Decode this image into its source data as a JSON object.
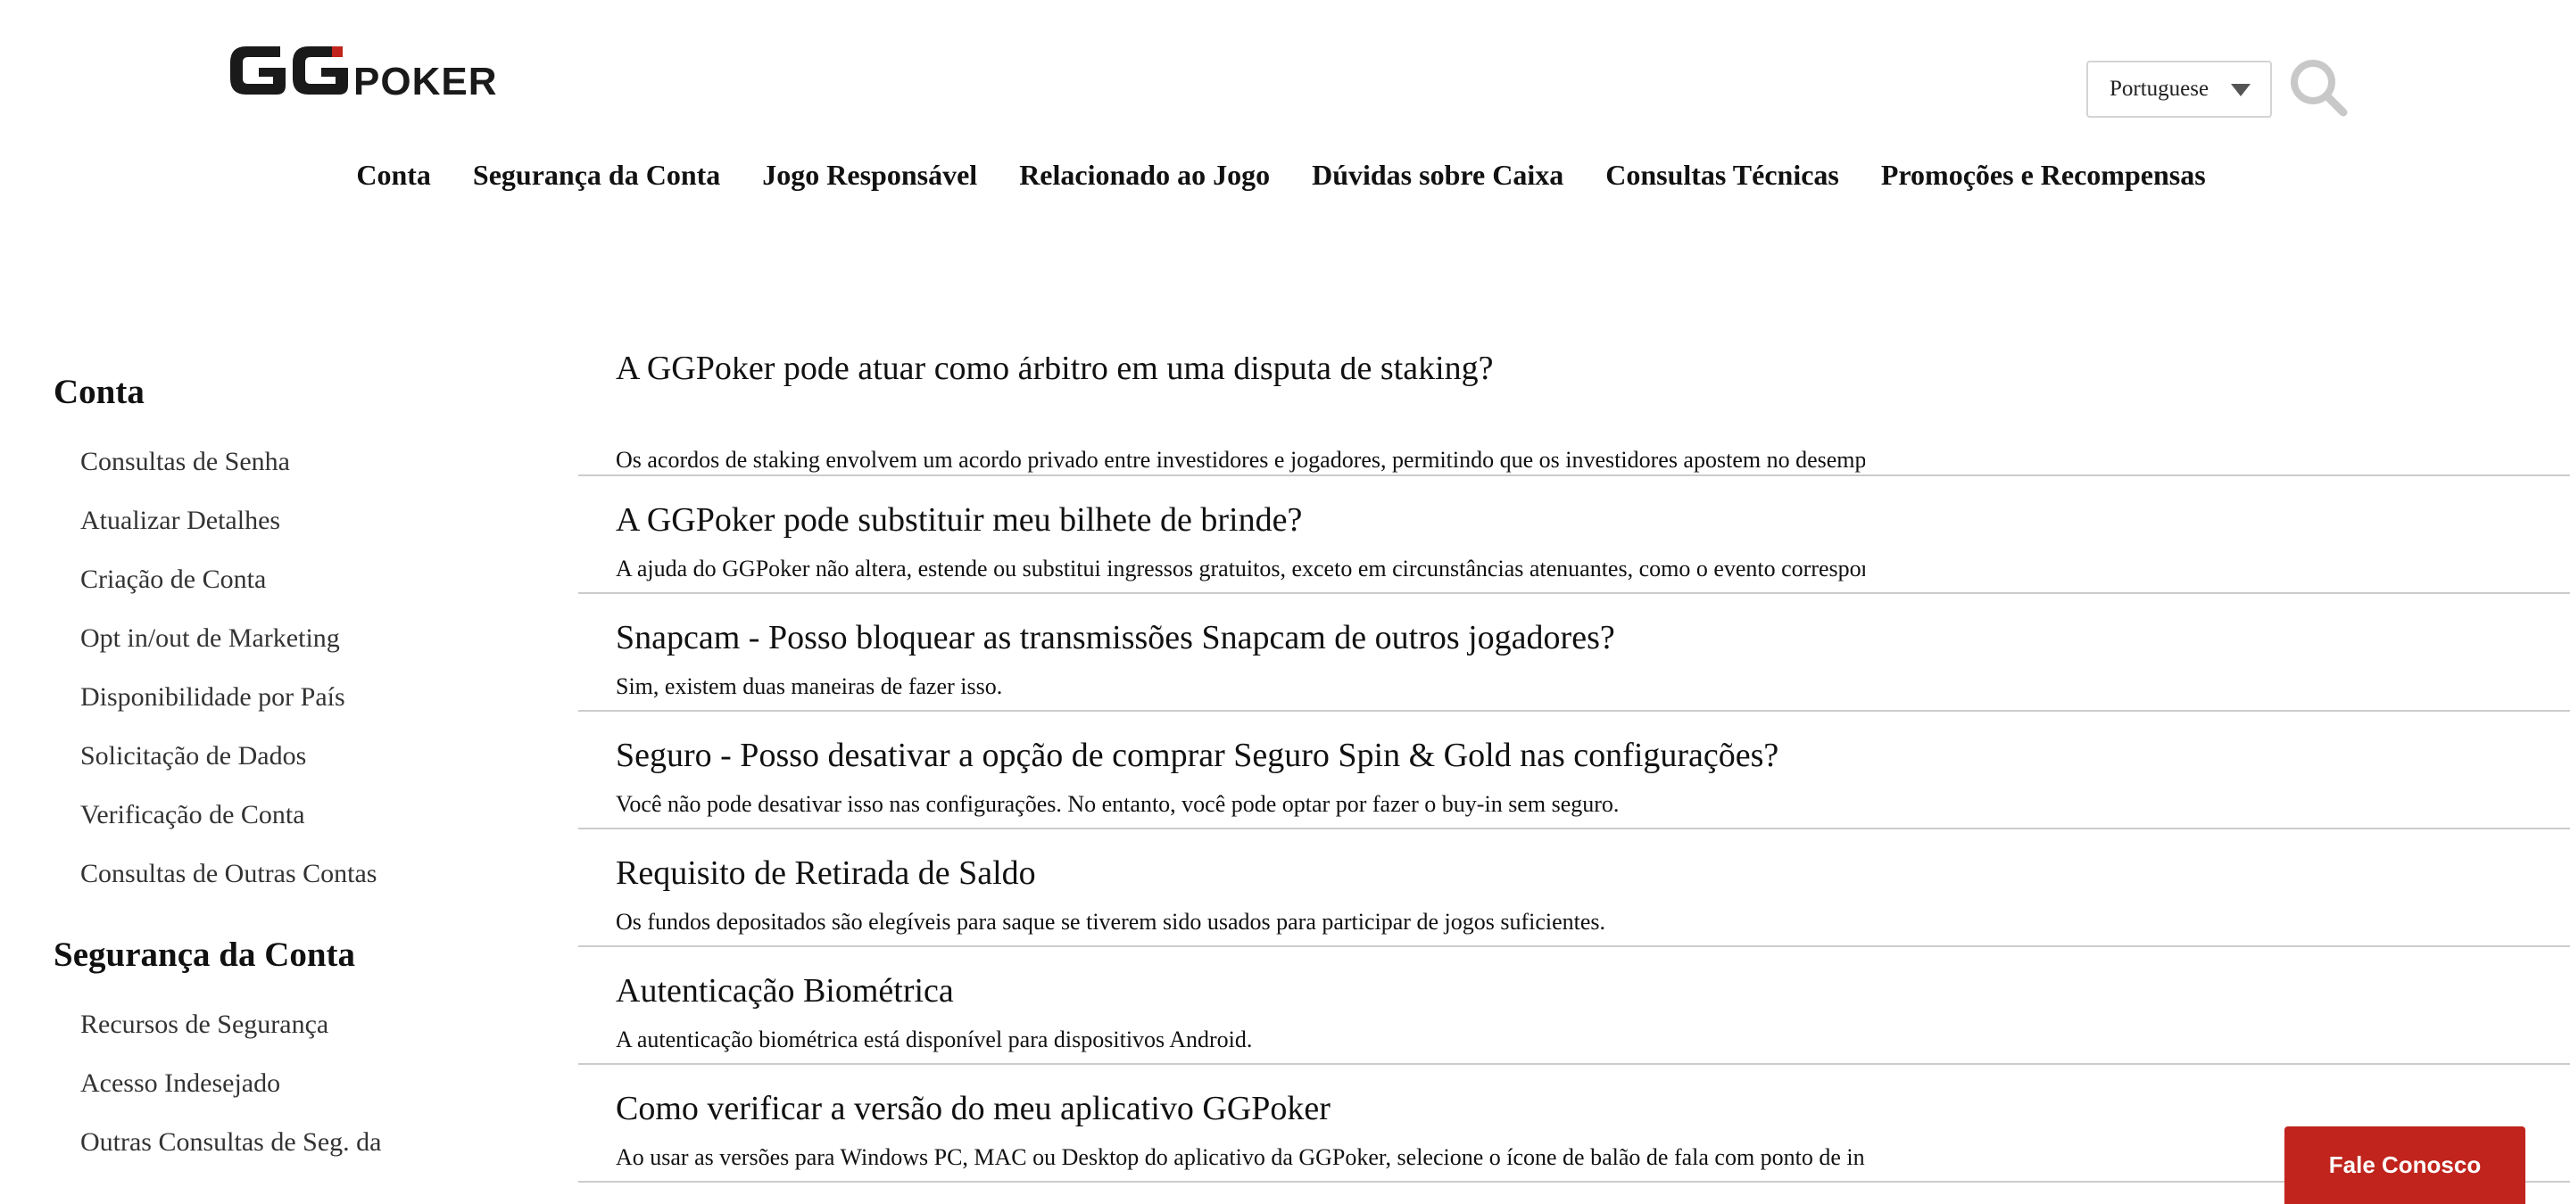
{
  "brand": {
    "logo_text": "GGPOKER",
    "accent_color": "#c0241c"
  },
  "header": {
    "language": {
      "selected": "Portuguese"
    },
    "search_icon": "search-icon"
  },
  "main_nav": [
    "Conta",
    "Segurança da Conta",
    "Jogo Responsável",
    "Relacionado ao Jogo",
    "Dúvidas sobre Caixa",
    "Consultas Técnicas",
    "Promoções e Recompensas"
  ],
  "sidebar": {
    "sections": [
      {
        "title": "Conta",
        "items": [
          "Consultas de Senha",
          "Atualizar Detalhes",
          "Criação de Conta",
          "Opt in/out de Marketing",
          "Disponibilidade por País",
          "Solicitação de Dados",
          "Verificação de Conta",
          "Consultas de Outras Contas"
        ]
      },
      {
        "title": "Segurança da Conta",
        "items": [
          "Recursos de Segurança",
          "Acesso Indesejado",
          "Outras Consultas de Seg. da"
        ]
      }
    ]
  },
  "articles": [
    {
      "title": "A GGPoker pode atuar como árbitro em uma disputa de staking?",
      "excerpt": "Os acordos de staking envolvem um acordo privado entre investidores e jogadores, permitindo que os investidores apostem no desempenho de um jogador e"
    },
    {
      "title": "A GGPoker pode substituir meu bilhete de brinde?",
      "excerpt": "A ajuda do GGPoker não altera, estende ou substitui ingressos gratuitos, exceto em circunstâncias atenuantes, como o evento correspondente não ocorrer ou"
    },
    {
      "title": "Snapcam - Posso bloquear as transmissões Snapcam de outros jogadores?",
      "excerpt": "Sim, existem duas maneiras de fazer isso."
    },
    {
      "title": "Seguro - Posso desativar a opção de comprar Seguro Spin & Gold nas configurações?",
      "excerpt": "Você não pode desativar isso nas configurações. No entanto, você pode optar por fazer o buy-in sem seguro."
    },
    {
      "title": "Requisito de Retirada de Saldo",
      "excerpt": "Os fundos depositados são elegíveis para saque se tiverem sido usados para participar de jogos suficientes."
    },
    {
      "title": "Autenticação Biométrica",
      "excerpt": "A autenticação biométrica está disponível para dispositivos Android."
    },
    {
      "title": "Como verificar a versão do meu aplicativo GGPoker",
      "excerpt": "Ao usar as versões para Windows PC, MAC ou Desktop do aplicativo da GGPoker, selecione o ícone de balão de fala com ponto de interrogação embutido n"
    }
  ],
  "contact_button": "Fale Conosco"
}
